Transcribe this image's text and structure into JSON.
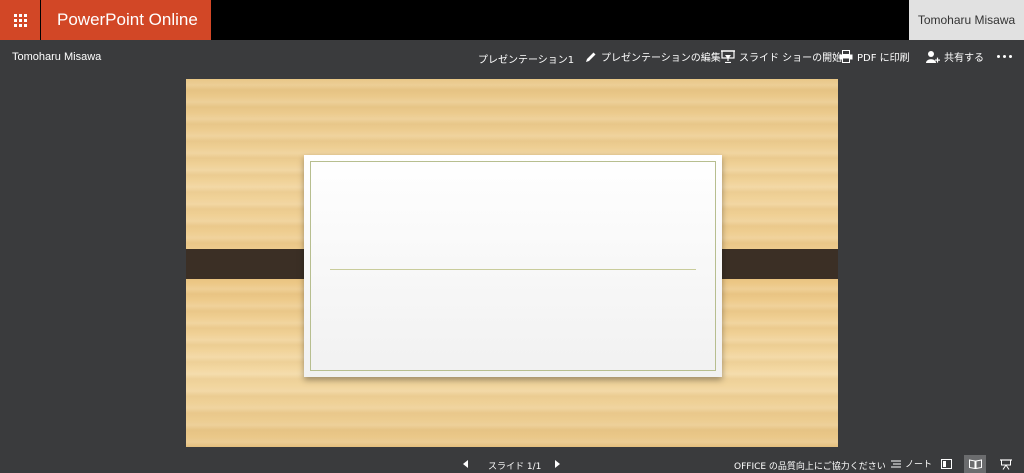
{
  "suite": {
    "app_name": "PowerPoint Online",
    "user_name": "Tomoharu Misawa",
    "brand_color": "#d24726"
  },
  "command_bar": {
    "author": "Tomoharu Misawa",
    "document_title": "プレゼンテーション1",
    "edit_label": "プレゼンテーションの編集",
    "slideshow_label": "スライド ショーの開始",
    "print_label": "PDF に印刷",
    "share_label": "共有する",
    "icons": [
      "pencil-icon",
      "chevron-down-icon",
      "projector-icon",
      "printer-icon",
      "add-person-icon",
      "more-icon"
    ]
  },
  "slide": {
    "background": "wood",
    "strap_color": "#3b2f25"
  },
  "status_bar": {
    "slide_counter": "スライド 1/1",
    "feedback": "OFFICE の品質向上にご協力ください",
    "notes_label": "ノート",
    "views": [
      "normal-view-icon",
      "reading-view-icon",
      "slideshow-view-icon"
    ],
    "active_view": "reading-view-icon"
  }
}
